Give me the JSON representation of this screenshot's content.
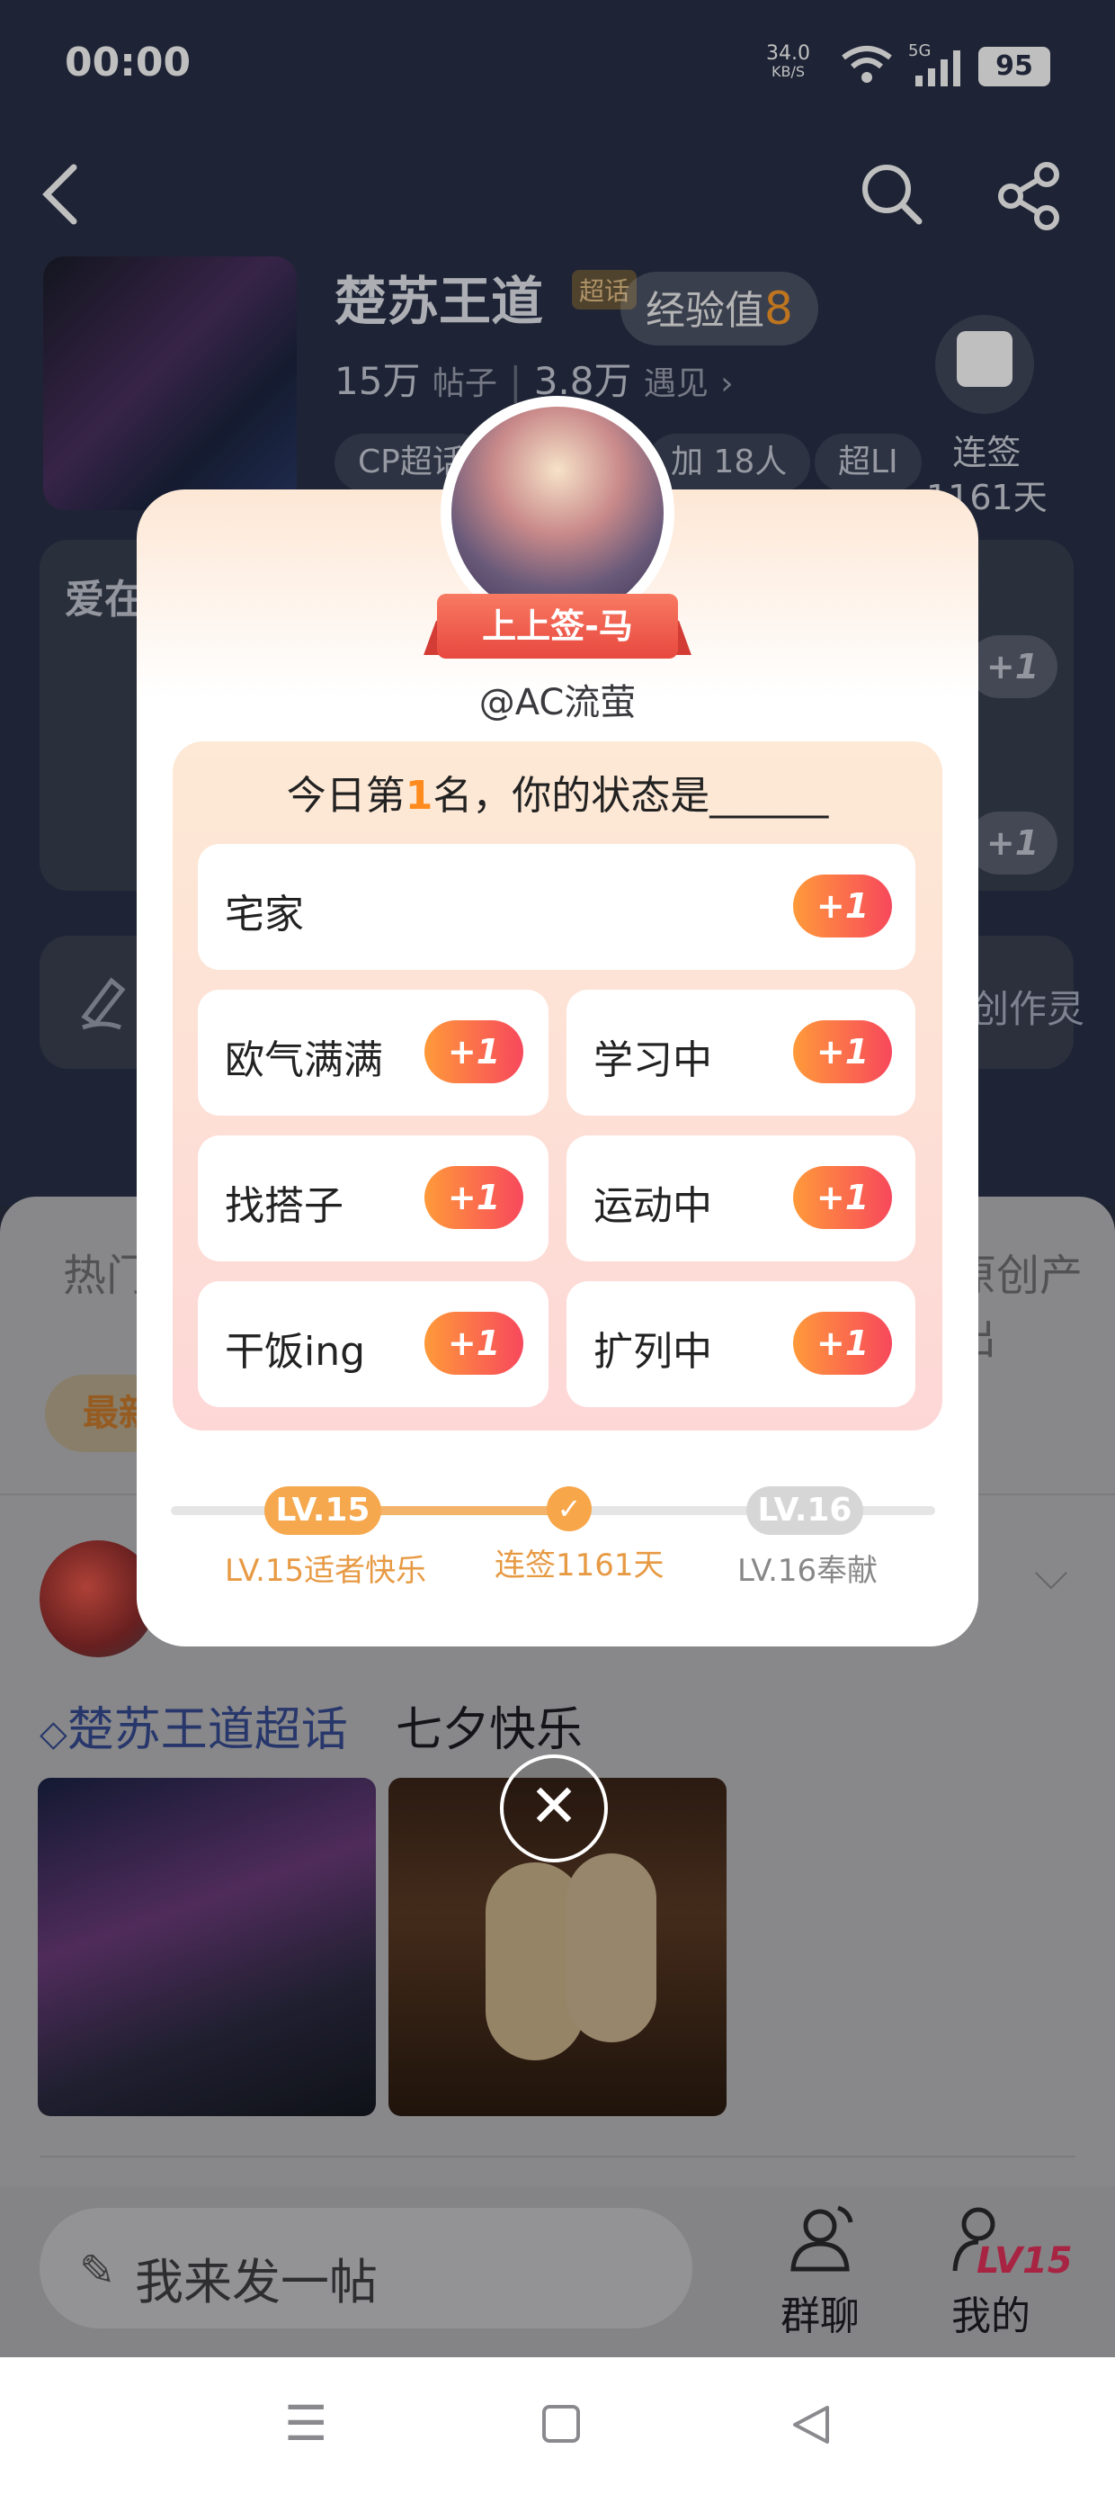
{
  "status_bar": {
    "time": "00:00",
    "net_speed": "34.0",
    "net_unit": "KB/S",
    "signal": "5G",
    "battery": "95"
  },
  "header": {
    "back_icon": "back-arrow-icon",
    "search_icon": "search-icon",
    "share_icon": "share-icon"
  },
  "topic": {
    "title": "楚苏王道",
    "badge": "超话",
    "exp_label": "经验值",
    "exp_value": "8",
    "posts": "15万",
    "posts_label": "帖子",
    "encounters": "3.8万",
    "encounters_label": "遇见",
    "chips": [
      "CP超话",
      "加 18人",
      "超LI"
    ],
    "streak_label": "连签",
    "streak_days": "1161天"
  },
  "background": {
    "love": "爱在",
    "plus": "+1",
    "create": "创作灵",
    "tab_hot": "热门",
    "tab_original": "原创产出",
    "newest": "最新"
  },
  "post": {
    "topic_tag": "楚苏王道超话",
    "text": "七夕快乐"
  },
  "bottom_bar": {
    "compose": "我来发一帖",
    "group_chat": "群聊",
    "mine": "我的",
    "level_badge": "LV15"
  },
  "modal": {
    "rank_badge": "上上签-马",
    "username": "@AC流萤",
    "question_prefix": "今日第",
    "question_rank": "1",
    "question_suffix": "名，你的状态是______",
    "plus": "+1",
    "options": [
      "宅家",
      "欧气满满",
      "学习中",
      "找搭子",
      "运动中",
      "干饭ing",
      "扩列中"
    ],
    "progress": {
      "current_level": "LV.15",
      "next_level": "LV.16",
      "current_label": "LV.15适者快乐",
      "streak_label": "连签1161天",
      "next_label": "LV.16奉献"
    },
    "close_icon": "close-icon"
  },
  "colors": {
    "accent": "#ff8a1e",
    "plus_gradient_start": "#ff9a3a",
    "plus_gradient_end": "#f7485c",
    "level_badge": "#e0305a"
  }
}
